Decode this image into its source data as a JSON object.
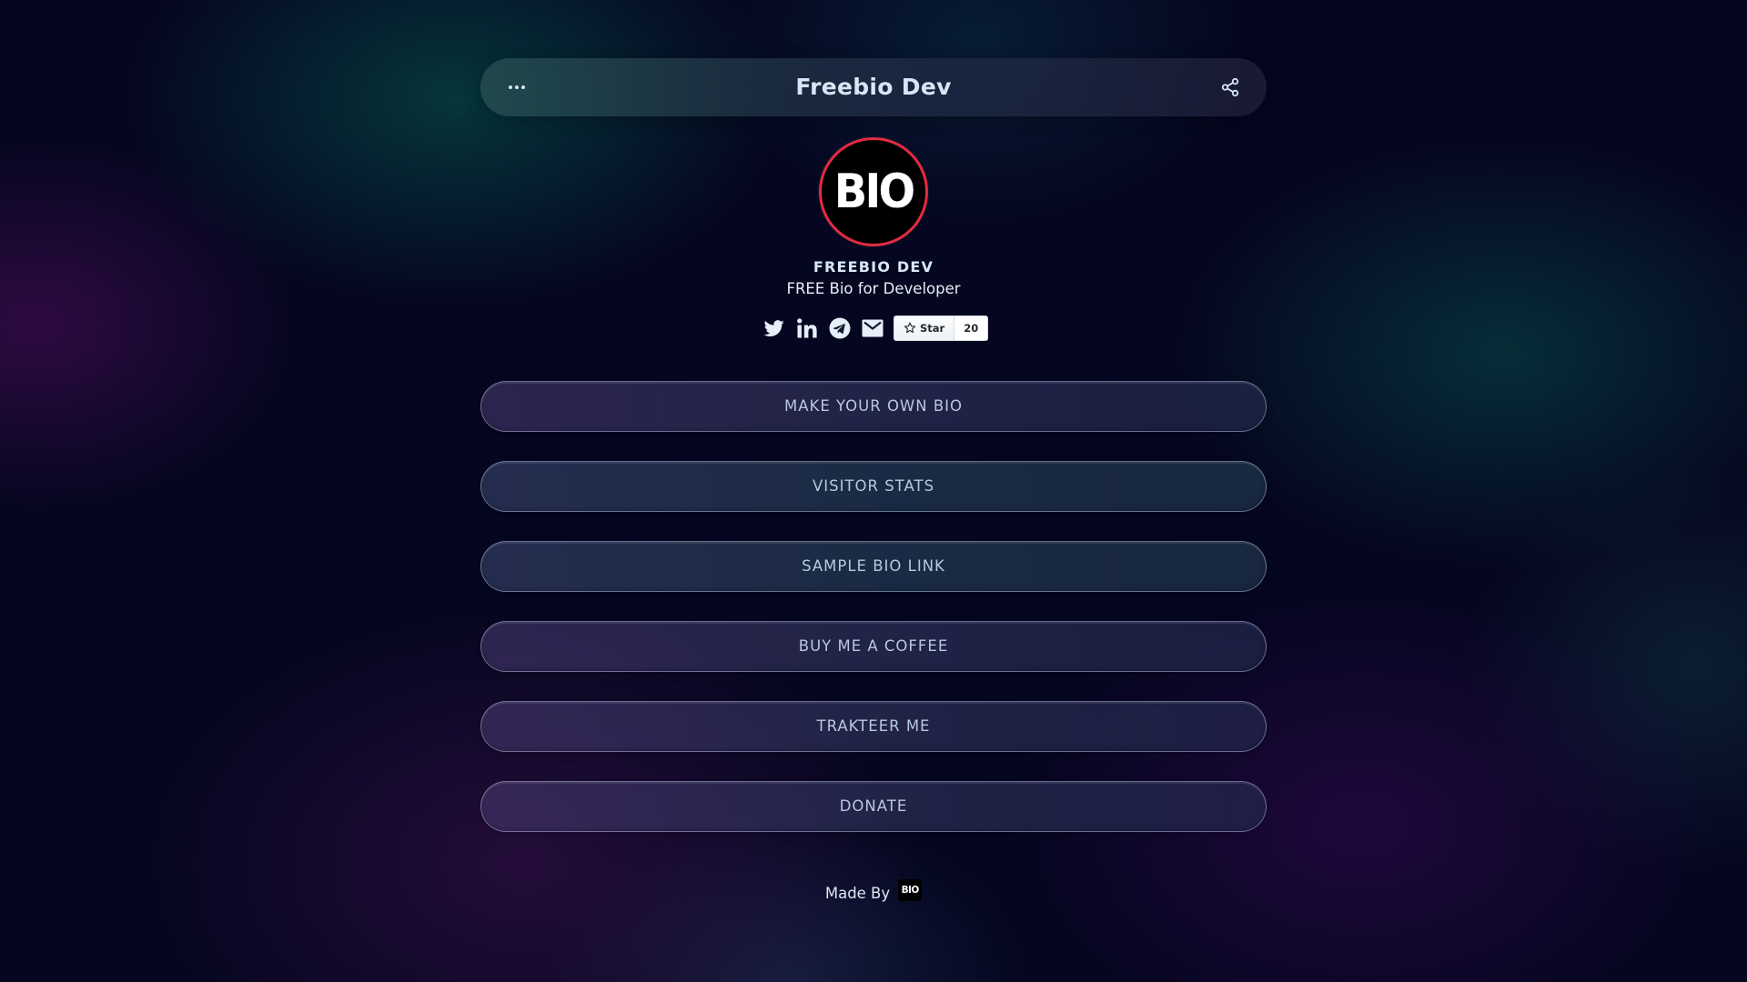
{
  "header": {
    "title": "Freebio Dev",
    "menu_icon": "more-dots-icon",
    "share_icon": "share-icon"
  },
  "profile": {
    "avatar_text": "BIO",
    "name": "FREEBIO DEV",
    "bio": "FREE Bio for Developer"
  },
  "socials": [
    {
      "icon": "twitter-icon"
    },
    {
      "icon": "linkedin-icon"
    },
    {
      "icon": "telegram-icon"
    },
    {
      "icon": "email-icon"
    }
  ],
  "github_star": {
    "label": "Star",
    "count": "20"
  },
  "links": [
    {
      "label": "MAKE YOUR OWN BIO"
    },
    {
      "label": "VISITOR STATS"
    },
    {
      "label": "SAMPLE BIO LINK"
    },
    {
      "label": "BUY ME A COFFEE"
    },
    {
      "label": "TRAKTEER ME"
    },
    {
      "label": "DONATE"
    }
  ],
  "footer": {
    "text": "Made By",
    "logo_text": "BIO"
  },
  "colors": {
    "background": "#05061f",
    "avatar_ring": "#e32a40",
    "text_light": "#d8e6f4",
    "button_text": "#b9c8dc"
  }
}
